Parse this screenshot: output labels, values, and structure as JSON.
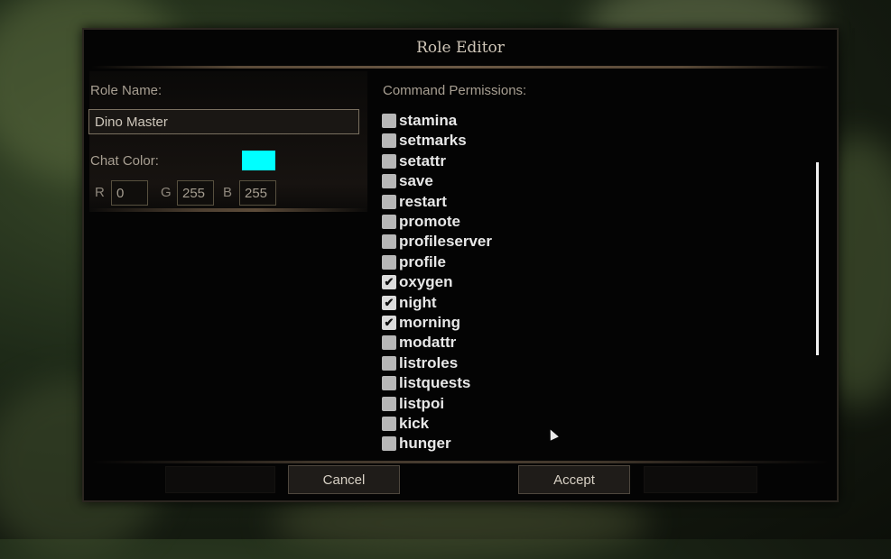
{
  "dialog": {
    "title": "Role Editor"
  },
  "role": {
    "name_label": "Role Name:",
    "name_value": "Dino Master"
  },
  "chat_color": {
    "label": "Chat Color:",
    "swatch_color": "#00ffff",
    "r_label": "R",
    "r_value": "0",
    "g_label": "G",
    "g_value": "255",
    "b_label": "B",
    "b_value": "255"
  },
  "permissions": {
    "label": "Command Permissions:",
    "items": [
      {
        "label": "stamina",
        "checked": false
      },
      {
        "label": "setmarks",
        "checked": false
      },
      {
        "label": "setattr",
        "checked": false
      },
      {
        "label": "save",
        "checked": false
      },
      {
        "label": "restart",
        "checked": false
      },
      {
        "label": "promote",
        "checked": false
      },
      {
        "label": "profileserver",
        "checked": false
      },
      {
        "label": "profile",
        "checked": false
      },
      {
        "label": "oxygen",
        "checked": true
      },
      {
        "label": "night",
        "checked": true
      },
      {
        "label": "morning",
        "checked": true
      },
      {
        "label": "modattr",
        "checked": false
      },
      {
        "label": "listroles",
        "checked": false
      },
      {
        "label": "listquests",
        "checked": false
      },
      {
        "label": "listpoi",
        "checked": false
      },
      {
        "label": "kick",
        "checked": false
      },
      {
        "label": "hunger",
        "checked": false
      }
    ]
  },
  "footer": {
    "cancel_label": "Cancel",
    "accept_label": "Accept"
  },
  "icons": {
    "checkmark": "checkmark-icon",
    "cursor": "mouse-cursor-icon"
  }
}
